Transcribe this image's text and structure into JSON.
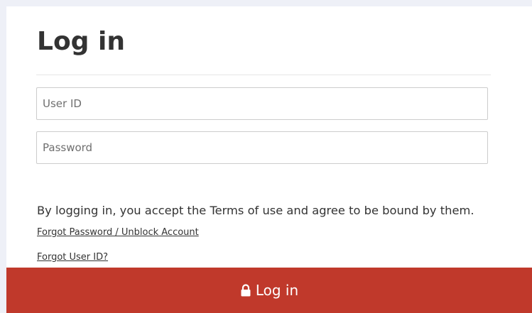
{
  "login": {
    "title": "Log in",
    "user_id_placeholder": "User ID",
    "password_placeholder": "Password",
    "terms_text": "By logging in, you accept the Terms of use and agree to be bound by them.",
    "forgot_password_link": "Forgot Password / Unblock Account",
    "forgot_user_id_link": "Forgot User ID?",
    "submit_label": "Log in",
    "submit_icon": "lock-icon",
    "accent_color": "#c0392b"
  }
}
